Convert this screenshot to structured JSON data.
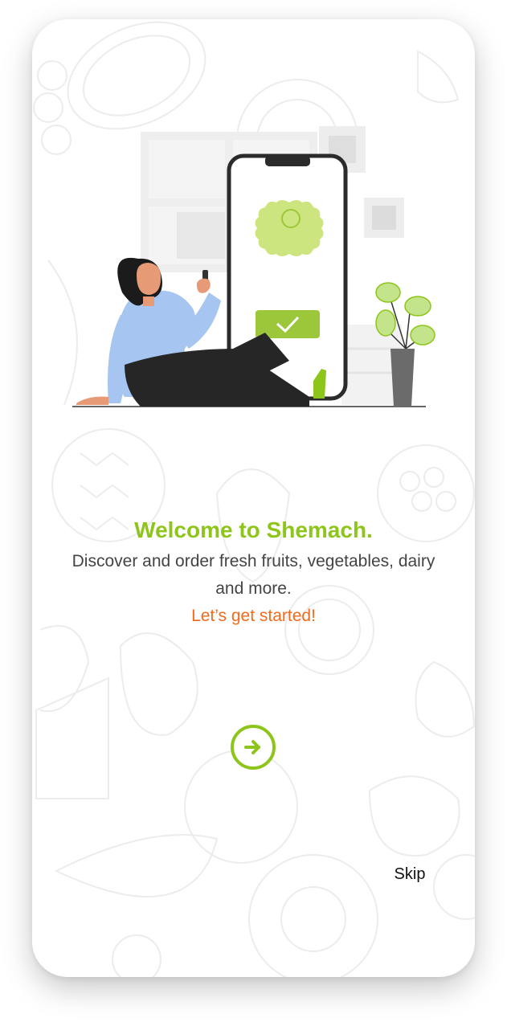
{
  "onboarding": {
    "title": "Welcome to Shemach.",
    "description": "Discover and order fresh fruits, vegetables, dairy and more.",
    "cta": "Let’s get started!",
    "skip_label": "Skip",
    "next_icon": "arrow-right-circle-icon"
  },
  "colors": {
    "brand_green": "#8ec51b",
    "accent_orange": "#f26a1b",
    "text_dark": "#444444"
  }
}
